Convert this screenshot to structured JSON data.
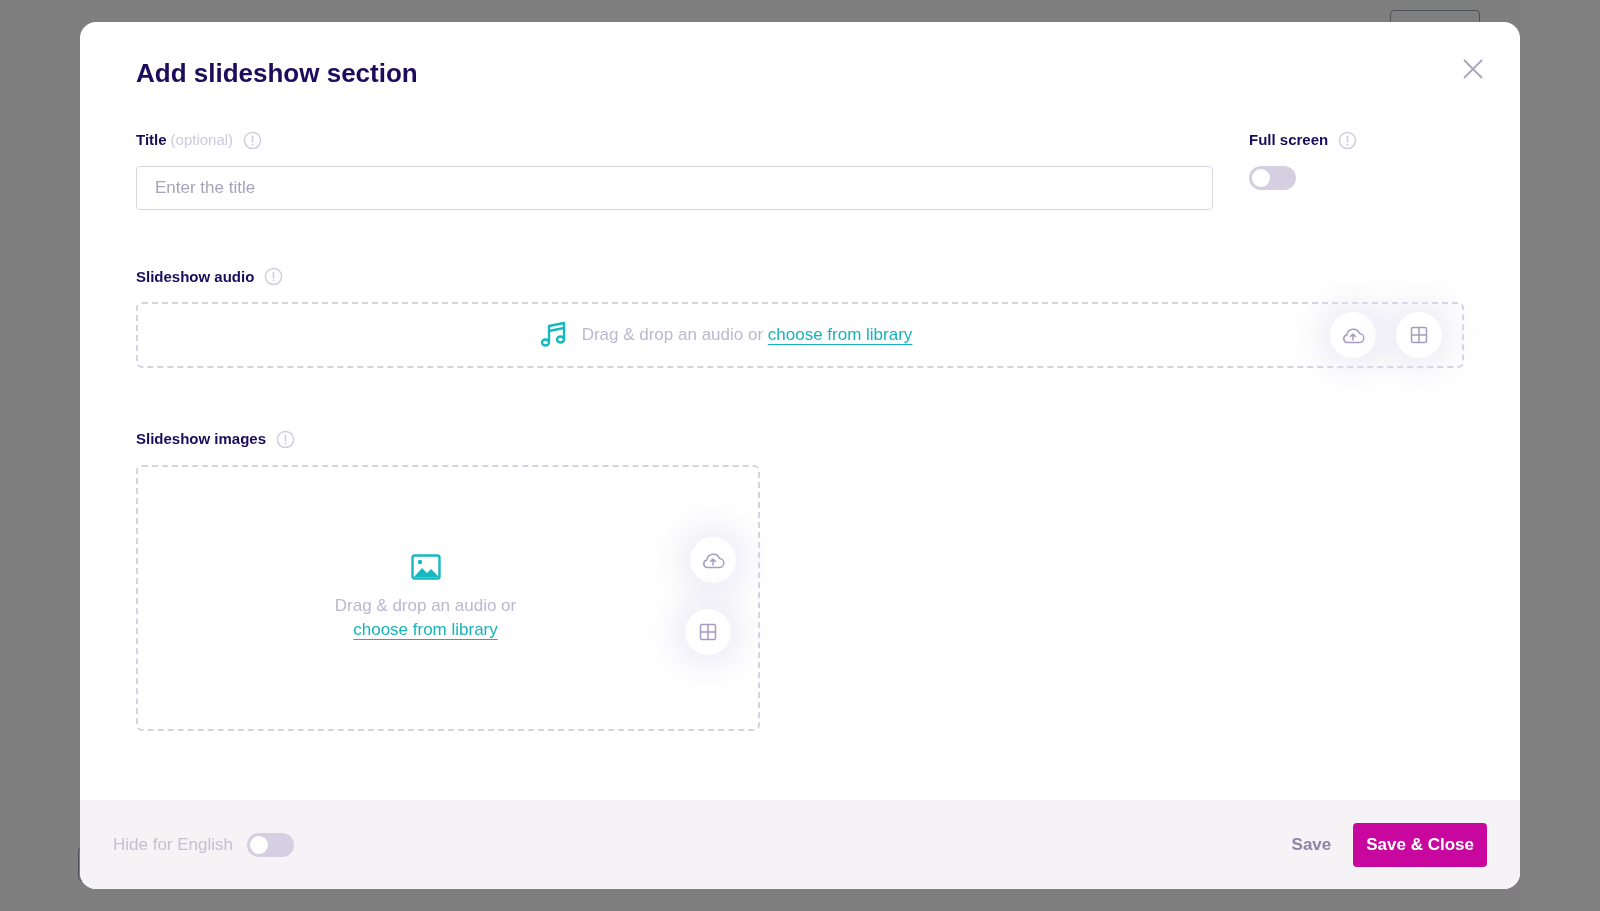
{
  "dialog": {
    "title": "Add slideshow section",
    "title_field": {
      "label": "Title",
      "hint": "(optional)",
      "placeholder": "Enter the title"
    },
    "full_screen": {
      "label": "Full screen",
      "on": false
    },
    "audio": {
      "label": "Slideshow audio",
      "prompt": "Drag & drop an audio or",
      "link": "choose from library"
    },
    "images": {
      "label": "Slideshow images",
      "prompt": "Drag & drop an audio or",
      "link": "choose from library"
    },
    "footer": {
      "hide_toggle": {
        "label": "Hide for English",
        "on": false
      },
      "buttons": [
        {
          "label": "Save",
          "kind": "secondary"
        },
        {
          "label": "Save & Close",
          "kind": "primary"
        }
      ]
    }
  }
}
